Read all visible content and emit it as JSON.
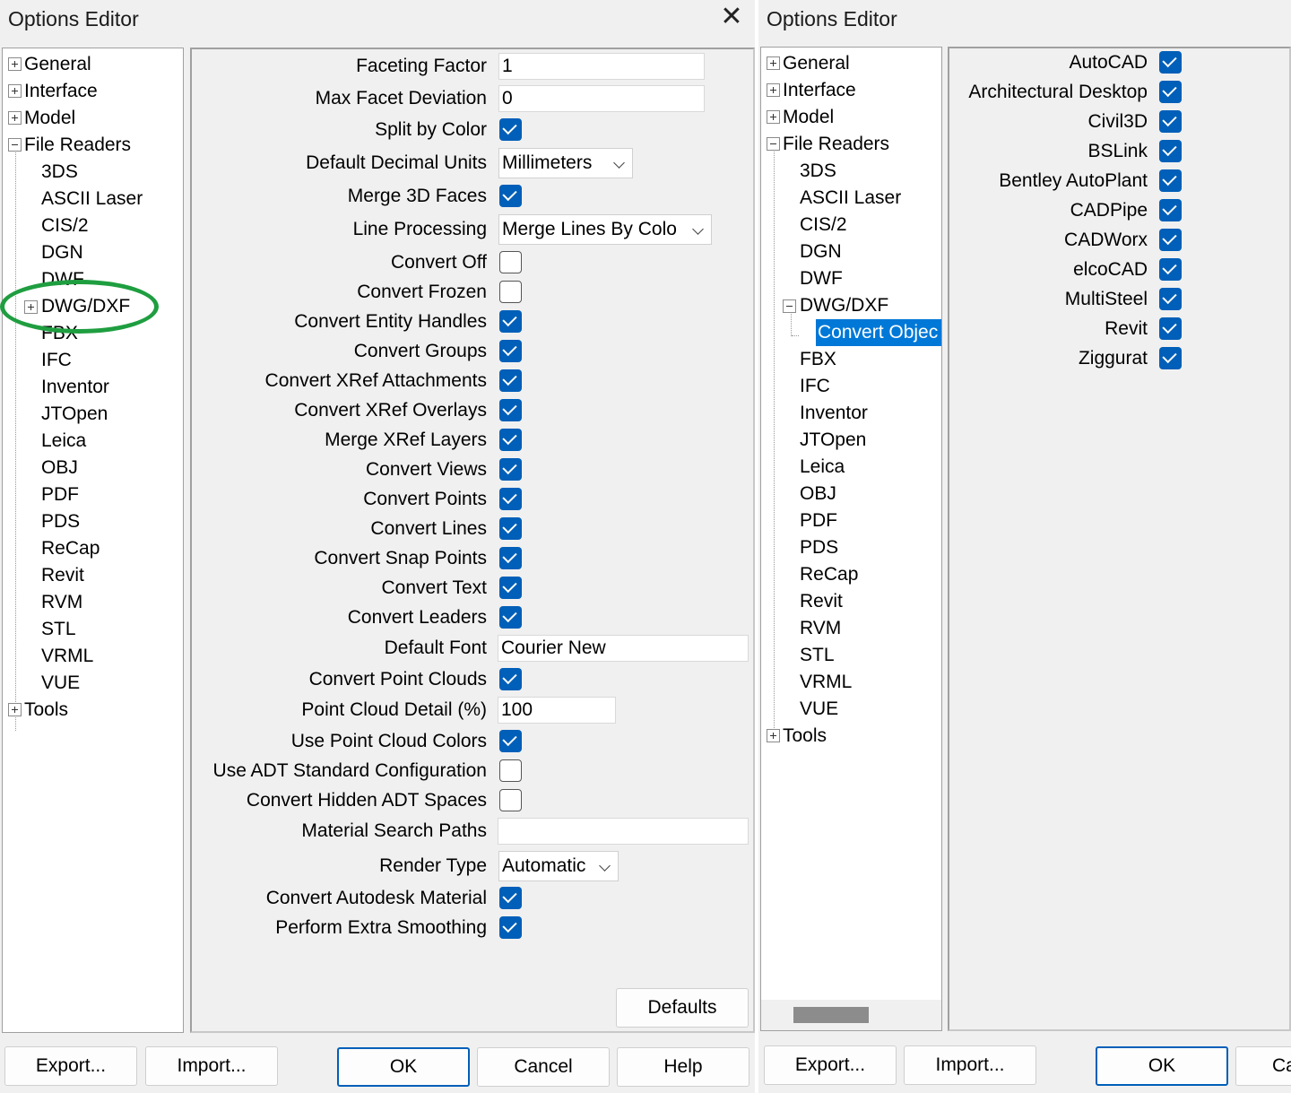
{
  "left": {
    "title": "Options Editor",
    "close": "✕",
    "tree": {
      "top": [
        "General",
        "Interface",
        "Model",
        "File Readers"
      ],
      "children": [
        "3DS",
        "ASCII Laser",
        "CIS/2",
        "DGN",
        "DWF",
        "DWG/DXF",
        "FBX",
        "IFC",
        "Inventor",
        "JTOpen",
        "Leica",
        "OBJ",
        "PDF",
        "PDS",
        "ReCap",
        "Revit",
        "RVM",
        "STL",
        "VRML",
        "VUE"
      ],
      "last": "Tools"
    },
    "fields": {
      "faceting_factor": {
        "label": "Faceting Factor",
        "value": "1"
      },
      "max_facet_deviation": {
        "label": "Max Facet Deviation",
        "value": "0"
      },
      "split_by_color": {
        "label": "Split by Color",
        "checked": true
      },
      "default_decimal_units": {
        "label": "Default Decimal Units",
        "value": "Millimeters"
      },
      "merge_3d_faces": {
        "label": "Merge 3D Faces",
        "checked": true
      },
      "line_processing": {
        "label": "Line Processing",
        "value": "Merge Lines By Colo"
      },
      "convert_off": {
        "label": "Convert Off",
        "checked": false
      },
      "convert_frozen": {
        "label": "Convert Frozen",
        "checked": false
      },
      "convert_entity_handles": {
        "label": "Convert Entity Handles",
        "checked": true
      },
      "convert_groups": {
        "label": "Convert Groups",
        "checked": true
      },
      "convert_xref_attachments": {
        "label": "Convert XRef Attachments",
        "checked": true
      },
      "convert_xref_overlays": {
        "label": "Convert XRef Overlays",
        "checked": true
      },
      "merge_xref_layers": {
        "label": "Merge XRef Layers",
        "checked": true
      },
      "convert_views": {
        "label": "Convert Views",
        "checked": true
      },
      "convert_points": {
        "label": "Convert Points",
        "checked": true
      },
      "convert_lines": {
        "label": "Convert Lines",
        "checked": true
      },
      "convert_snap_points": {
        "label": "Convert Snap Points",
        "checked": true
      },
      "convert_text": {
        "label": "Convert Text",
        "checked": true
      },
      "convert_leaders": {
        "label": "Convert Leaders",
        "checked": true
      },
      "default_font": {
        "label": "Default Font",
        "value": "Courier New"
      },
      "convert_point_clouds": {
        "label": "Convert Point Clouds",
        "checked": true
      },
      "point_cloud_detail": {
        "label": "Point Cloud Detail (%)",
        "value": "100"
      },
      "use_point_cloud_colors": {
        "label": "Use Point Cloud Colors",
        "checked": true
      },
      "use_adt_standard_configuration": {
        "label": "Use ADT Standard Configuration",
        "checked": false
      },
      "convert_hidden_adt_spaces": {
        "label": "Convert Hidden ADT Spaces",
        "checked": false
      },
      "material_search_paths": {
        "label": "Material Search Paths",
        "value": ""
      },
      "render_type": {
        "label": "Render Type",
        "value": "Automatic"
      },
      "convert_autodesk_material": {
        "label": "Convert Autodesk Material",
        "checked": true
      },
      "perform_extra_smoothing": {
        "label": "Perform Extra Smoothing",
        "checked": true
      }
    },
    "defaults_button": "Defaults",
    "buttons": {
      "export": "Export...",
      "import": "Import...",
      "ok": "OK",
      "cancel": "Cancel",
      "help": "Help"
    }
  },
  "right": {
    "title": "Options Editor",
    "tree": {
      "top": [
        "General",
        "Interface",
        "Model",
        "File Readers"
      ],
      "before": [
        "3DS",
        "ASCII Laser",
        "CIS/2",
        "DGN",
        "DWF"
      ],
      "dwg": "DWG/DXF",
      "selected": "Convert Objec",
      "after": [
        "FBX",
        "IFC",
        "Inventor",
        "JTOpen",
        "Leica",
        "OBJ",
        "PDF",
        "PDS",
        "ReCap",
        "Revit",
        "RVM",
        "STL",
        "VRML",
        "VUE"
      ],
      "last": "Tools"
    },
    "apps": [
      {
        "label": "AutoCAD",
        "checked": true
      },
      {
        "label": "Architectural Desktop",
        "checked": true
      },
      {
        "label": "Civil3D",
        "checked": true
      },
      {
        "label": "BSLink",
        "checked": true
      },
      {
        "label": "Bentley AutoPlant",
        "checked": true
      },
      {
        "label": "CADPipe",
        "checked": true
      },
      {
        "label": "CADWorx",
        "checked": true
      },
      {
        "label": "elcoCAD",
        "checked": true
      },
      {
        "label": "MultiSteel",
        "checked": true
      },
      {
        "label": "Revit",
        "checked": true
      },
      {
        "label": "Ziggurat",
        "checked": true
      }
    ],
    "buttons": {
      "export": "Export...",
      "import": "Import...",
      "ok": "OK",
      "cancel": "Ca"
    }
  },
  "colors": {
    "checkbox_accent": "#005fb8",
    "selection": "#0078d7",
    "highlight_ellipse": "#1f9e40"
  }
}
